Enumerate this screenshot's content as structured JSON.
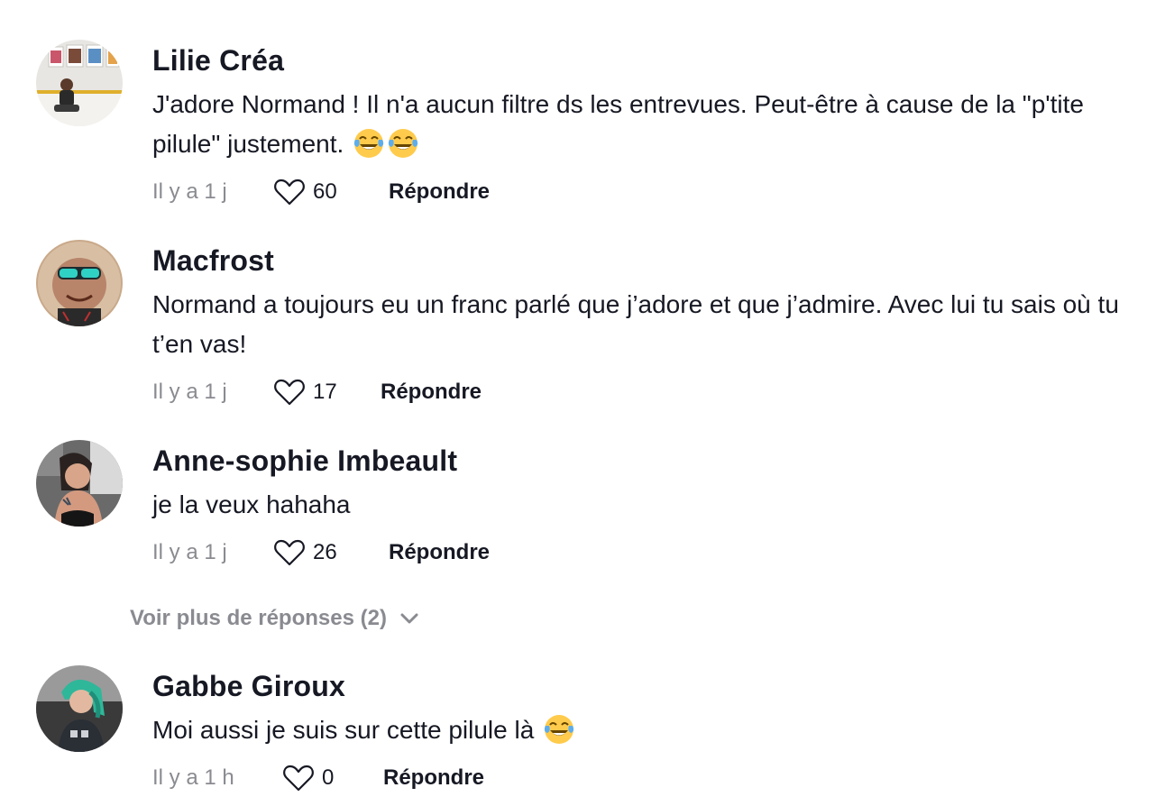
{
  "colors": {
    "text": "#161823",
    "muted": "#8a8b91",
    "background": "#ffffff"
  },
  "comments": [
    {
      "username": "Lilie Créa",
      "text": "J'adore Normand ! Il n'a aucun filtre ds les entrevues. Peut-être à cause de la \"p'tite pilule\" justement.",
      "emoji": [
        "face-with-tears-of-joy",
        "face-with-tears-of-joy"
      ],
      "time": "Il y a 1 j",
      "likes": "60",
      "reply_label": "Répondre"
    },
    {
      "username": "Macfrost",
      "text": "Normand a toujours eu un franc parlé que j’adore et que j’admire. Avec lui tu sais où tu t’en vas!",
      "time": "Il y a 1 j",
      "likes": "17",
      "reply_label": "Répondre"
    },
    {
      "username": "Anne-sophie Imbeault",
      "text": "je la veux hahaha",
      "time": "Il y a 1 j",
      "likes": "26",
      "reply_label": "Répondre"
    },
    {
      "username": "Gabbe Giroux",
      "text": "Moi aussi je suis sur cette pilule là",
      "emoji": [
        "face-with-tears-of-joy"
      ],
      "time": "Il y a 1 h",
      "likes": "0",
      "reply_label": "Répondre"
    }
  ],
  "view_more_replies": "Voir plus de réponses (2)"
}
